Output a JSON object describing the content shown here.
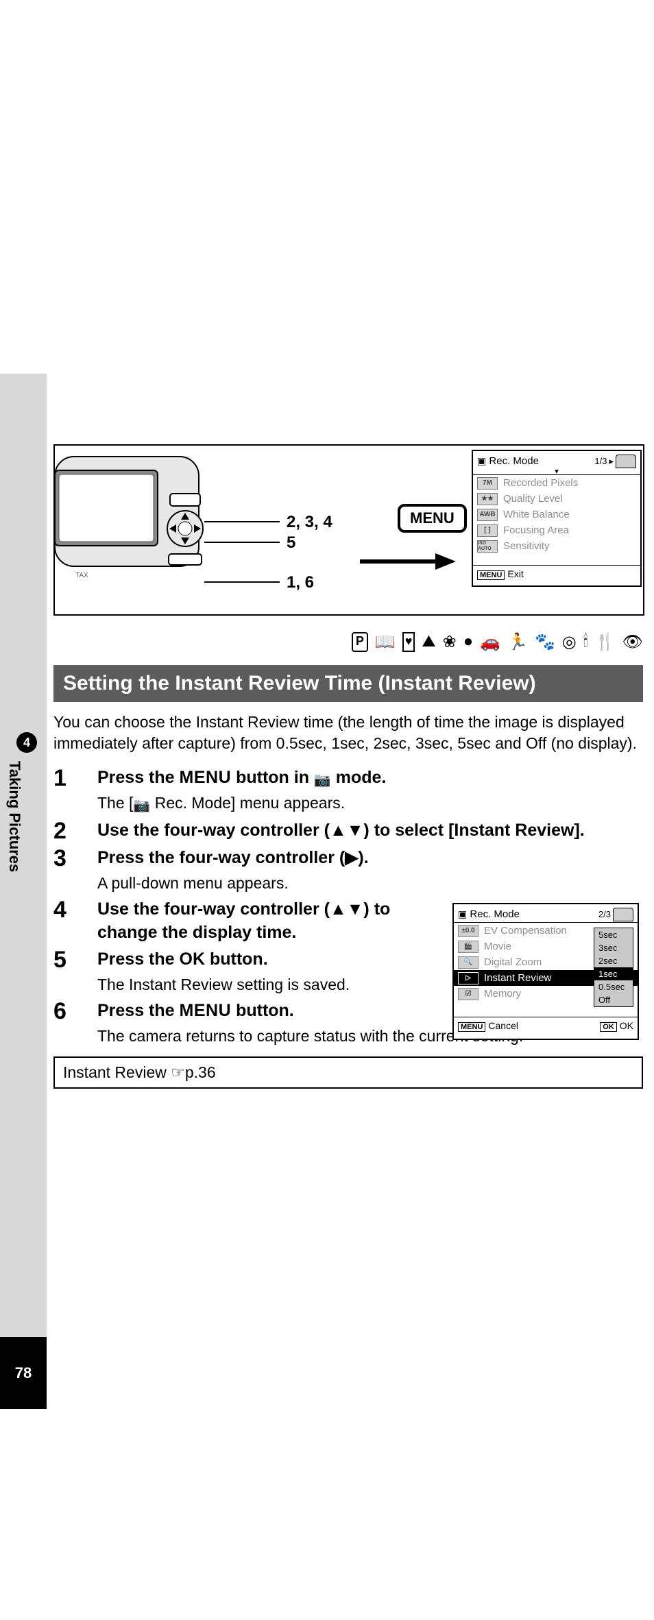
{
  "side": {
    "chapter_num": "4",
    "chapter_label": "Taking Pictures",
    "page_num": "78"
  },
  "callouts": {
    "c234": "2, 3, 4",
    "c5": "5",
    "c16": "1, 6"
  },
  "menu_badge": "MENU",
  "lcd1": {
    "title": "Rec. Mode",
    "page": "1/3",
    "rows": [
      {
        "icon": "7M",
        "label": "Recorded Pixels"
      },
      {
        "icon": "★★",
        "label": "Quality Level"
      },
      {
        "icon": "AWB",
        "label": "White Balance"
      },
      {
        "icon": "[ ]",
        "label": "Focusing Area"
      },
      {
        "icon": "ISO AUTO",
        "label": "Sensitivity"
      }
    ],
    "footer_menu": "MENU",
    "footer_label": "Exit"
  },
  "mode_icons": [
    "P",
    "📖",
    "♥",
    "⛰",
    "❀",
    "●",
    "🚗",
    "🏃",
    "🐾",
    "◎",
    "🕯",
    "🍴",
    "👁"
  ],
  "heading": "Setting the Instant Review Time (Instant Review)",
  "intro": "You can choose the Instant Review time (the length of time the image is displayed immediately after capture) from 0.5sec, 1sec, 2sec, 3sec, 5sec and Off (no display).",
  "steps": [
    {
      "num": "1",
      "title_pre": "Press the ",
      "title_strong": "MENU",
      "title_mid": " button in ",
      "title_icon": "📷",
      "title_post": " mode.",
      "sub_pre": "The [",
      "sub_icon": "📷",
      "sub_post": " Rec. Mode] menu appears."
    },
    {
      "num": "2",
      "title": "Use the four-way controller (▲▼) to select [Instant Review]."
    },
    {
      "num": "3",
      "title": "Press the four-way controller (▶).",
      "sub": "A pull-down menu appears."
    },
    {
      "num": "4",
      "title": "Use the four-way controller (▲▼) to change the display time."
    },
    {
      "num": "5",
      "title_pre": "Press the ",
      "title_strong": "OK",
      "title_post": " button.",
      "sub": "The Instant Review setting is saved."
    },
    {
      "num": "6",
      "title_pre": "Press the ",
      "title_strong": "MENU",
      "title_post": " button.",
      "sub": "The camera returns to capture status with the current setting."
    }
  ],
  "lcd2": {
    "title": "Rec. Mode",
    "page": "2/3",
    "rows": [
      {
        "icon": "±0.0",
        "label": "EV Compensation"
      },
      {
        "icon": "🎬",
        "label": "Movie"
      },
      {
        "icon": "🔍",
        "label": "Digital Zoom"
      },
      {
        "icon": "▷",
        "label": "Instant Review",
        "highlight": true
      },
      {
        "icon": "☑",
        "label": "Memory"
      }
    ],
    "dropdown": [
      "5sec",
      "3sec",
      "2sec",
      "1sec",
      "0.5sec",
      "Off"
    ],
    "dropdown_selected": "1sec",
    "footer_menu": "MENU",
    "footer_cancel": "Cancel",
    "footer_ok_box": "OK",
    "footer_ok": "OK"
  },
  "ref_box": "Instant Review ☞p.36"
}
